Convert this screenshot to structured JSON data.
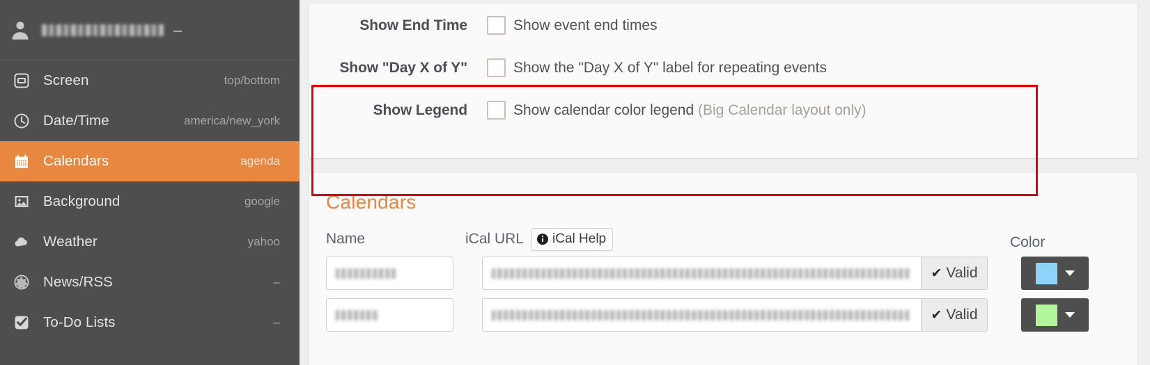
{
  "colors": {
    "accent": "#e8873f",
    "sidebar_bg": "#4e4e4e",
    "page_bg": "#efefef",
    "card_bg": "#fafafa",
    "highlight_box": "#ee0000",
    "swatch_blue": "#8ed4f8",
    "swatch_green": "#b3f59b"
  },
  "sidebar": {
    "user": {
      "name": "",
      "name_redacted": true,
      "avatar_icon": "user-avatar-icon",
      "caret_icon": "caret-icon"
    },
    "items": [
      {
        "icon": "screen-icon",
        "label": "Screen",
        "value": "top/bottom",
        "active": false
      },
      {
        "icon": "clock-icon",
        "label": "Date/Time",
        "value": "america/new_york",
        "active": false
      },
      {
        "icon": "calendar-icon",
        "label": "Calendars",
        "value": "agenda",
        "active": true
      },
      {
        "icon": "image-icon",
        "label": "Background",
        "value": "google",
        "active": false
      },
      {
        "icon": "cloud-icon",
        "label": "Weather",
        "value": "yahoo",
        "active": false
      },
      {
        "icon": "globe-icon",
        "label": "News/RSS",
        "value": "–",
        "active": false
      },
      {
        "icon": "check-square-icon",
        "label": "To-Do Lists",
        "value": "–",
        "active": false
      }
    ]
  },
  "settings_panel": {
    "rows": [
      {
        "label": "Show End Time",
        "checkbox_name": "show-end-time-checkbox",
        "checked": false,
        "text": "Show event end times",
        "muted": ""
      },
      {
        "label": "Show \"Day X of Y\"",
        "checkbox_name": "show-day-x-of-y-checkbox",
        "checked": false,
        "text": "Show the \"Day X of Y\" label for repeating events",
        "muted": ""
      },
      {
        "label": "Show Legend",
        "checkbox_name": "show-legend-checkbox",
        "checked": false,
        "text": "Show calendar color legend ",
        "muted": "(Big Calendar layout only)"
      }
    ]
  },
  "calendars_panel": {
    "title": "Calendars",
    "columns": {
      "name": "Name",
      "url": "iCal URL",
      "color": "Color"
    },
    "ical_help": {
      "label": "iCal Help",
      "icon": "info-circle-icon"
    },
    "rows": [
      {
        "name_value": "",
        "name_redacted": true,
        "url_value": "",
        "url_redacted": true,
        "status_label": "Valid",
        "status_icon": "check-icon",
        "color": "#8ed4f8"
      },
      {
        "name_value": "",
        "name_redacted": true,
        "url_value": "",
        "url_redacted": true,
        "status_label": "Valid",
        "status_icon": "check-icon",
        "color": "#b3f59b"
      }
    ]
  }
}
